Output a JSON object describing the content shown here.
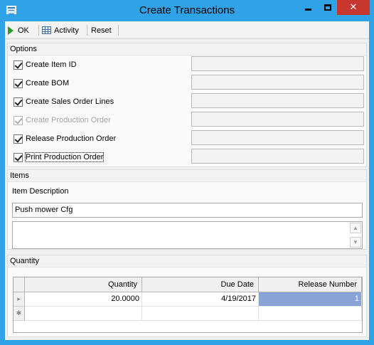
{
  "window": {
    "title": "Create Transactions",
    "close_glyph": "✕"
  },
  "toolbar": {
    "ok_label": "OK",
    "activity_label": "Activity",
    "reset_label": "Reset"
  },
  "options": {
    "header": "Options",
    "items": [
      {
        "label": "Create Item ID",
        "checked": true,
        "enabled": true,
        "value": ""
      },
      {
        "label": "Create BOM",
        "checked": true,
        "enabled": true,
        "value": ""
      },
      {
        "label": "Create Sales Order Lines",
        "checked": true,
        "enabled": true,
        "value": ""
      },
      {
        "label": "Create Production Order",
        "checked": true,
        "enabled": false,
        "value": ""
      },
      {
        "label": "Release Production Order",
        "checked": true,
        "enabled": true,
        "value": ""
      },
      {
        "label": "Print Production Order",
        "checked": true,
        "enabled": true,
        "value": ""
      }
    ]
  },
  "items": {
    "header": "Items",
    "description_label": "Item Description",
    "description_value": "Push mower Cfg",
    "memo_value": ""
  },
  "quantity": {
    "header": "Quantity",
    "columns": [
      "Quantity",
      "Due Date",
      "Release Number"
    ],
    "rows": [
      {
        "quantity": "20.0000",
        "due_date": "4/19/2017",
        "release_number": "1"
      }
    ],
    "new_row_marker": "✱",
    "current_row_marker": "▸"
  }
}
